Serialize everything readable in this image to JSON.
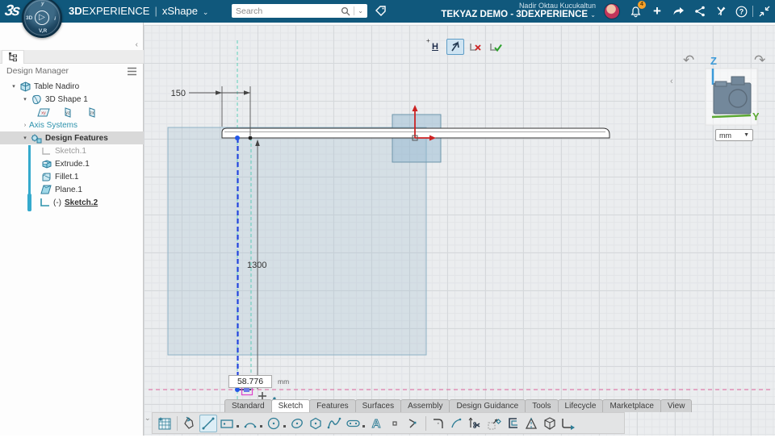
{
  "topbar": {
    "logo": "3s",
    "brand_bold": "3D",
    "brand_rest": "EXPERIENCE",
    "separator": "|",
    "app_name": "xShape",
    "app_chevron": "⌄",
    "search": {
      "placeholder": "Search"
    },
    "user_name": "Nadir Oktau Kucukaltun",
    "tenant": "TEKYAZ DEMO - 3DEXPERIENCE",
    "tenant_chevron": "⌄",
    "notification_count": "4",
    "icons": [
      "bell-icon",
      "add-icon",
      "share-arrow-icon",
      "share-network-icon",
      "swym-icon",
      "help-icon",
      "collapse-window-icon"
    ]
  },
  "compass": {
    "west": "3D",
    "south": "V,R",
    "north": "y",
    "east": "i"
  },
  "sidebar": {
    "collapse_chevron": "‹",
    "title": "Design Manager",
    "menu_icon": "hamburger-menu-icon",
    "tree": {
      "root": {
        "label": "Table Nadiro",
        "expander": "▾"
      },
      "shape": {
        "label": "3D Shape 1",
        "expander": "▾"
      },
      "axes": {
        "label": "Axis Systems",
        "expander": "›"
      },
      "features": {
        "label": "Design Features",
        "expander": "▾"
      },
      "sketch1": {
        "label": "Sketch.1"
      },
      "extrude1": {
        "label": "Extrude.1"
      },
      "fillet1": {
        "label": "Fillet.1"
      },
      "plane1": {
        "label": "Plane.1"
      },
      "sketch2": {
        "label": "Sketch.2",
        "prefix": "(-)"
      }
    }
  },
  "canvas": {
    "sketch_toolbar": {
      "h_button": "H"
    },
    "dimensions": {
      "width_dim": "150",
      "height_dim": "1300",
      "input_value": "58.776",
      "input_unit": "mm"
    },
    "axis_labels": {
      "z": "Z",
      "y": "Y"
    },
    "units_selector": {
      "value": "mm",
      "chevron": "▼"
    }
  },
  "tabs": {
    "active": "Sketch",
    "items": [
      {
        "label": "Standard"
      },
      {
        "label": "Sketch"
      },
      {
        "label": "Features"
      },
      {
        "label": "Surfaces"
      },
      {
        "label": "Assembly"
      },
      {
        "label": "Design Guidance"
      },
      {
        "label": "Tools"
      },
      {
        "label": "Lifecycle"
      },
      {
        "label": "Marketplace"
      },
      {
        "label": "View"
      }
    ]
  },
  "sketch_tools": [
    "sketch-grid",
    "trace",
    "line",
    "rectangle",
    "arc",
    "circle",
    "ellipse",
    "polygon",
    "spline",
    "slot",
    "text",
    "point",
    "profile",
    "corner-fillet",
    "tangent-arc",
    "trim",
    "transform",
    "offset",
    "mirror",
    "project-3d",
    "exit-corner"
  ],
  "colors": {
    "topbar": "#10587c",
    "accent_teal": "#2e93ad",
    "selection_blue": "#2244dd",
    "construction_teal": "#5fceba",
    "plane_fill": "#b8cdd9",
    "dimension": "#333333",
    "bottom_limit_pink": "#e0649c",
    "axis_red": "#cc2222",
    "axis_z_blue": "#3a9ad9",
    "axis_y_green": "#5aa832",
    "badge_orange": "#f6a12a"
  }
}
